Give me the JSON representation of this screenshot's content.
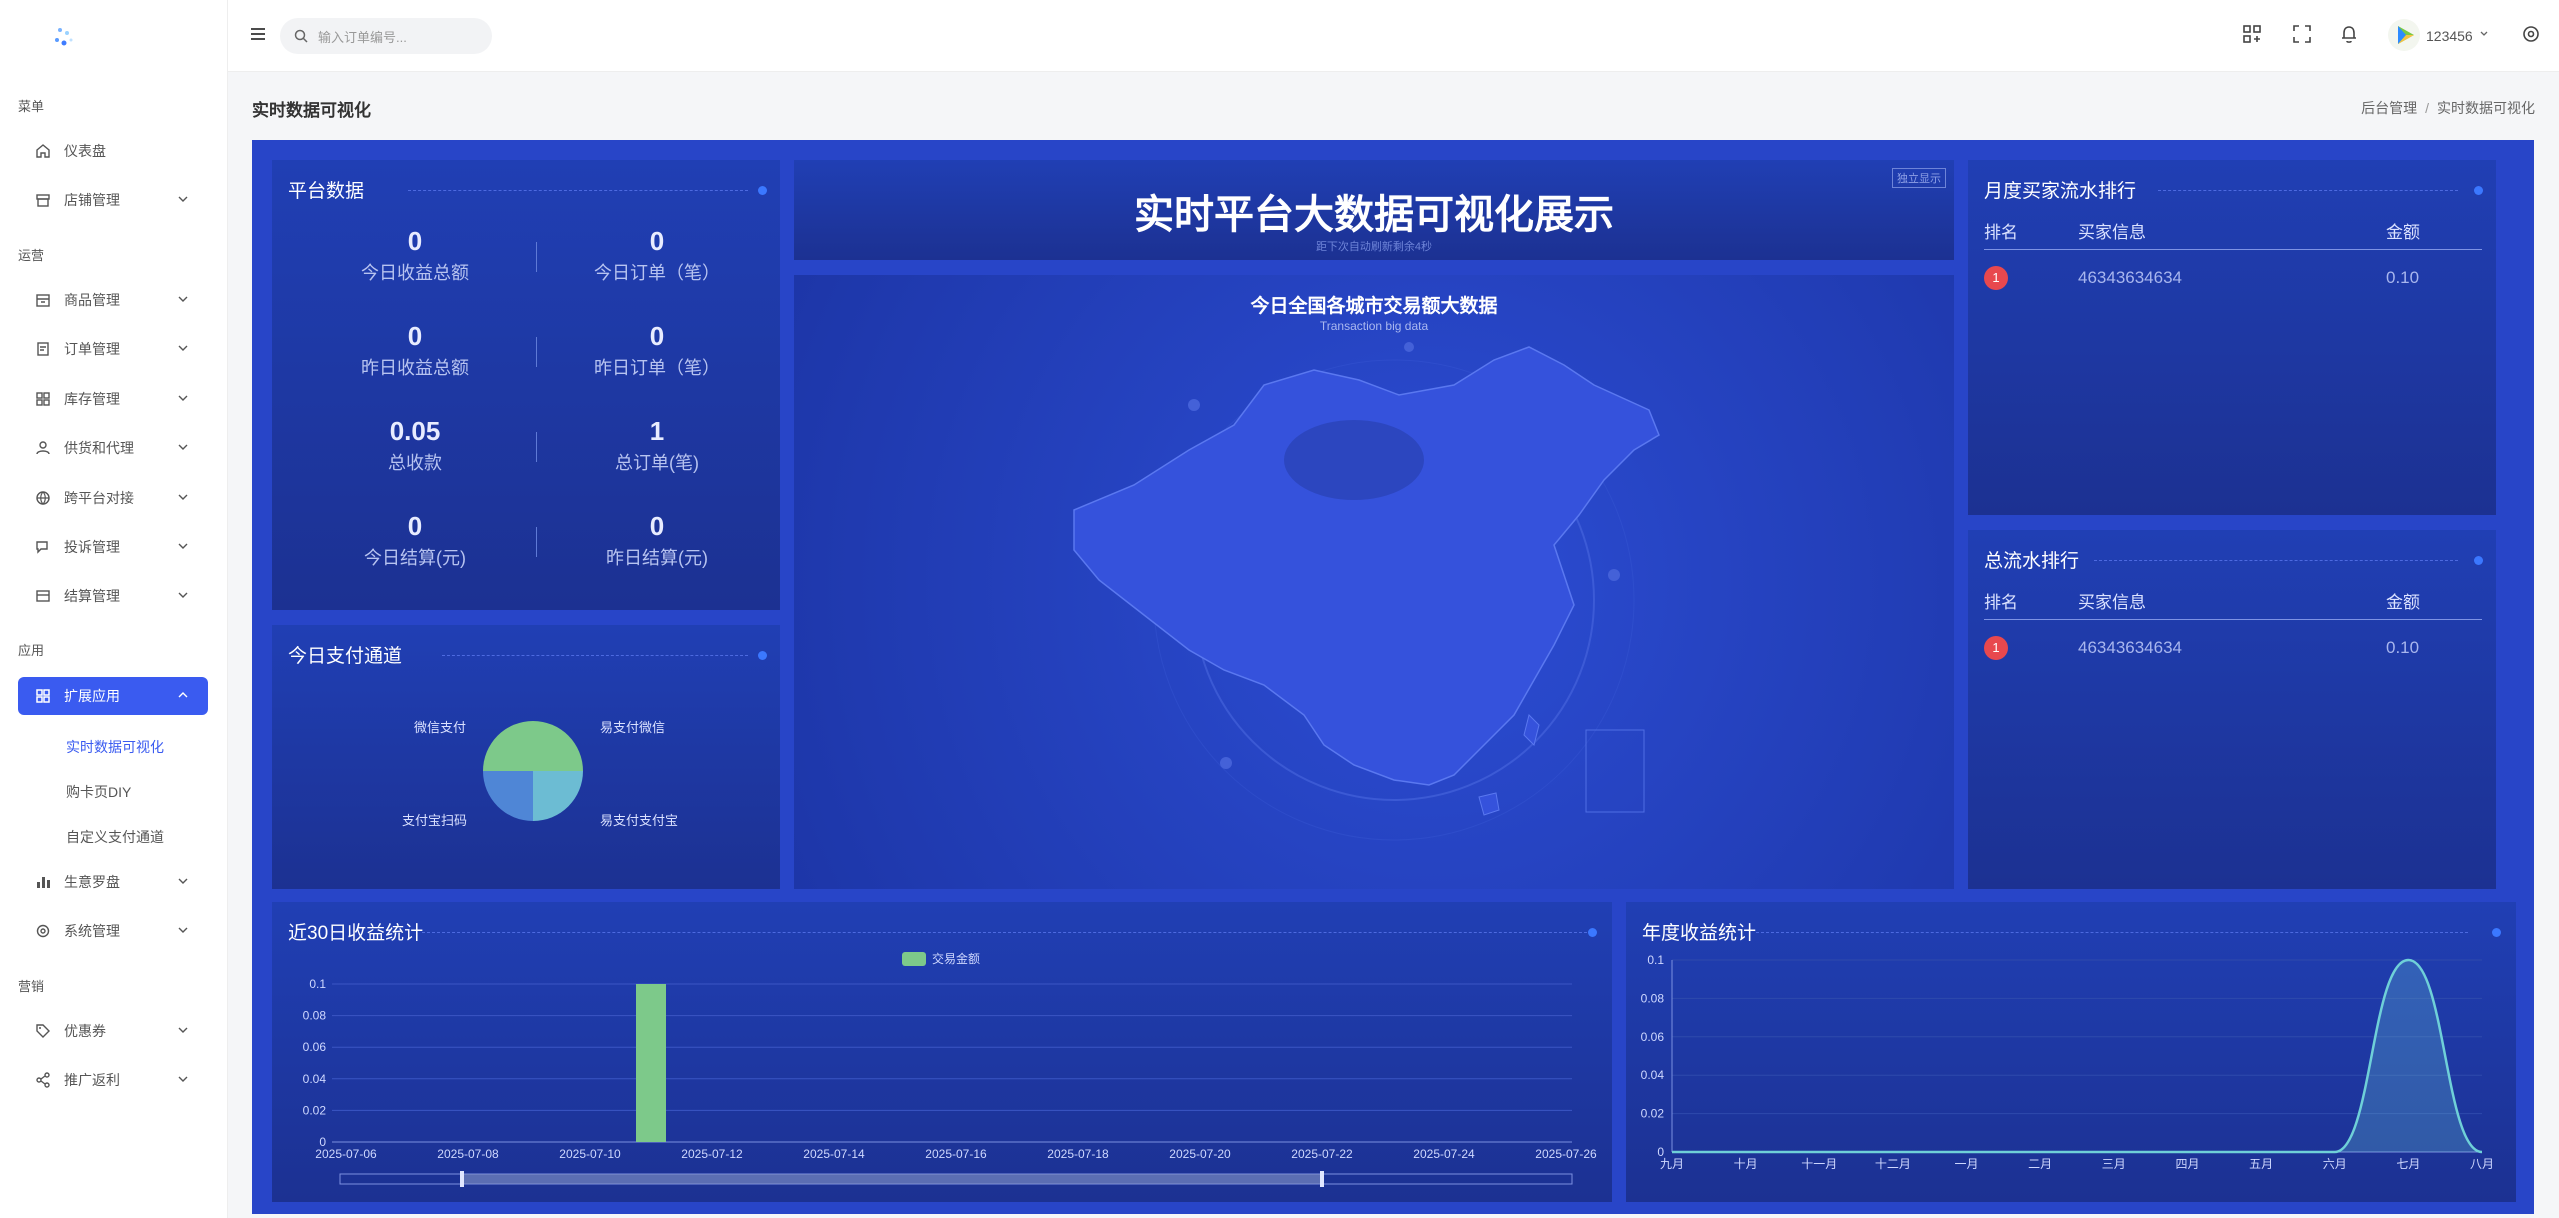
{
  "sidebar": {
    "sections": [
      "菜单",
      "运营",
      "应用",
      "营销"
    ],
    "items": [
      {
        "label": "仪表盘"
      },
      {
        "label": "店铺管理"
      },
      {
        "label": "商品管理"
      },
      {
        "label": "订单管理"
      },
      {
        "label": "库存管理"
      },
      {
        "label": "供货和代理"
      },
      {
        "label": "跨平台对接"
      },
      {
        "label": "投诉管理"
      },
      {
        "label": "结算管理"
      },
      {
        "label": "扩展应用"
      },
      {
        "label": "生意罗盘"
      },
      {
        "label": "系统管理"
      },
      {
        "label": "优惠券"
      },
      {
        "label": "推广返利"
      }
    ],
    "subitems": [
      {
        "label": "实时数据可视化"
      },
      {
        "label": "购卡页DIY"
      },
      {
        "label": "自定义支付通道"
      }
    ]
  },
  "topbar": {
    "search_placeholder": "输入订单编号...",
    "username": "123456"
  },
  "page": {
    "title": "实时数据可视化",
    "breadcrumb": [
      "后台管理",
      "实时数据可视化"
    ]
  },
  "dashboard": {
    "platform": {
      "title": "平台数据",
      "stats": [
        {
          "value": "0",
          "label": "今日收益总额"
        },
        {
          "value": "0",
          "label": "今日订单（笔）"
        },
        {
          "value": "0",
          "label": "昨日收益总额"
        },
        {
          "value": "0",
          "label": "昨日订单（笔）"
        },
        {
          "value": "0.05",
          "label": "总收款"
        },
        {
          "value": "1",
          "label": "总订单(笔)"
        },
        {
          "value": "0",
          "label": "今日结算(元)"
        },
        {
          "value": "0",
          "label": "昨日结算(元)"
        }
      ]
    },
    "payment": {
      "title": "今日支付通道",
      "labels": [
        "微信支付",
        "易支付微信",
        "支付宝扫码",
        "易支付支付宝"
      ],
      "slices": [
        {
          "name": "微信支付",
          "value": 50,
          "color": "#7dc98a"
        },
        {
          "name": "易支付支付宝",
          "value": 25,
          "color": "#6cbcd3"
        },
        {
          "name": "支付宝扫码",
          "value": 25,
          "color": "#4f86d6"
        }
      ]
    },
    "center": {
      "title": "实时平台大数据可视化展示",
      "note": "距下次自动刷新剩余4秒",
      "standalone": "独立显示",
      "map_title": "今日全国各城市交易额大数据",
      "map_subtitle": "Transaction big data"
    },
    "monthly_rank": {
      "title": "月度买家流水排行",
      "headers": [
        "排名",
        "买家信息",
        "金额"
      ],
      "rows": [
        {
          "rank": "1",
          "buyer": "46343634634",
          "amount": "0.10"
        }
      ]
    },
    "total_rank": {
      "title": "总流水排行",
      "headers": [
        "排名",
        "买家信息",
        "金额"
      ],
      "rows": [
        {
          "rank": "1",
          "buyer": "46343634634",
          "amount": "0.10"
        }
      ]
    },
    "recent30": {
      "title": "近30日收益统计"
    },
    "yearly": {
      "title": "年度收益统计"
    }
  },
  "chart_data": [
    {
      "type": "bar",
      "legend": [
        "交易金额"
      ],
      "categories": [
        "2025-07-06",
        "2025-07-08",
        "2025-07-10",
        "2025-07-12",
        "2025-07-14",
        "2025-07-16",
        "2025-07-18",
        "2025-07-20",
        "2025-07-22",
        "2025-07-24",
        "2025-07-26"
      ],
      "bar_date": "2025-07-11",
      "bar_value": 0.1,
      "yticks": [
        "0",
        "0.02",
        "0.04",
        "0.06",
        "0.08",
        "0.1"
      ],
      "ylim": [
        0,
        0.1
      ],
      "color": "#7dc98a"
    },
    {
      "type": "area",
      "categories": [
        "九月",
        "十月",
        "十一月",
        "十二月",
        "一月",
        "二月",
        "三月",
        "四月",
        "五月",
        "六月",
        "七月",
        "八月"
      ],
      "values": [
        0,
        0,
        0,
        0,
        0,
        0,
        0,
        0,
        0,
        0,
        0.1,
        0
      ],
      "yticks": [
        "0",
        "0.02",
        "0.04",
        "0.06",
        "0.08",
        "0.1"
      ],
      "ylim": [
        0,
        0.1
      ],
      "color": "#6fd0d8"
    }
  ]
}
